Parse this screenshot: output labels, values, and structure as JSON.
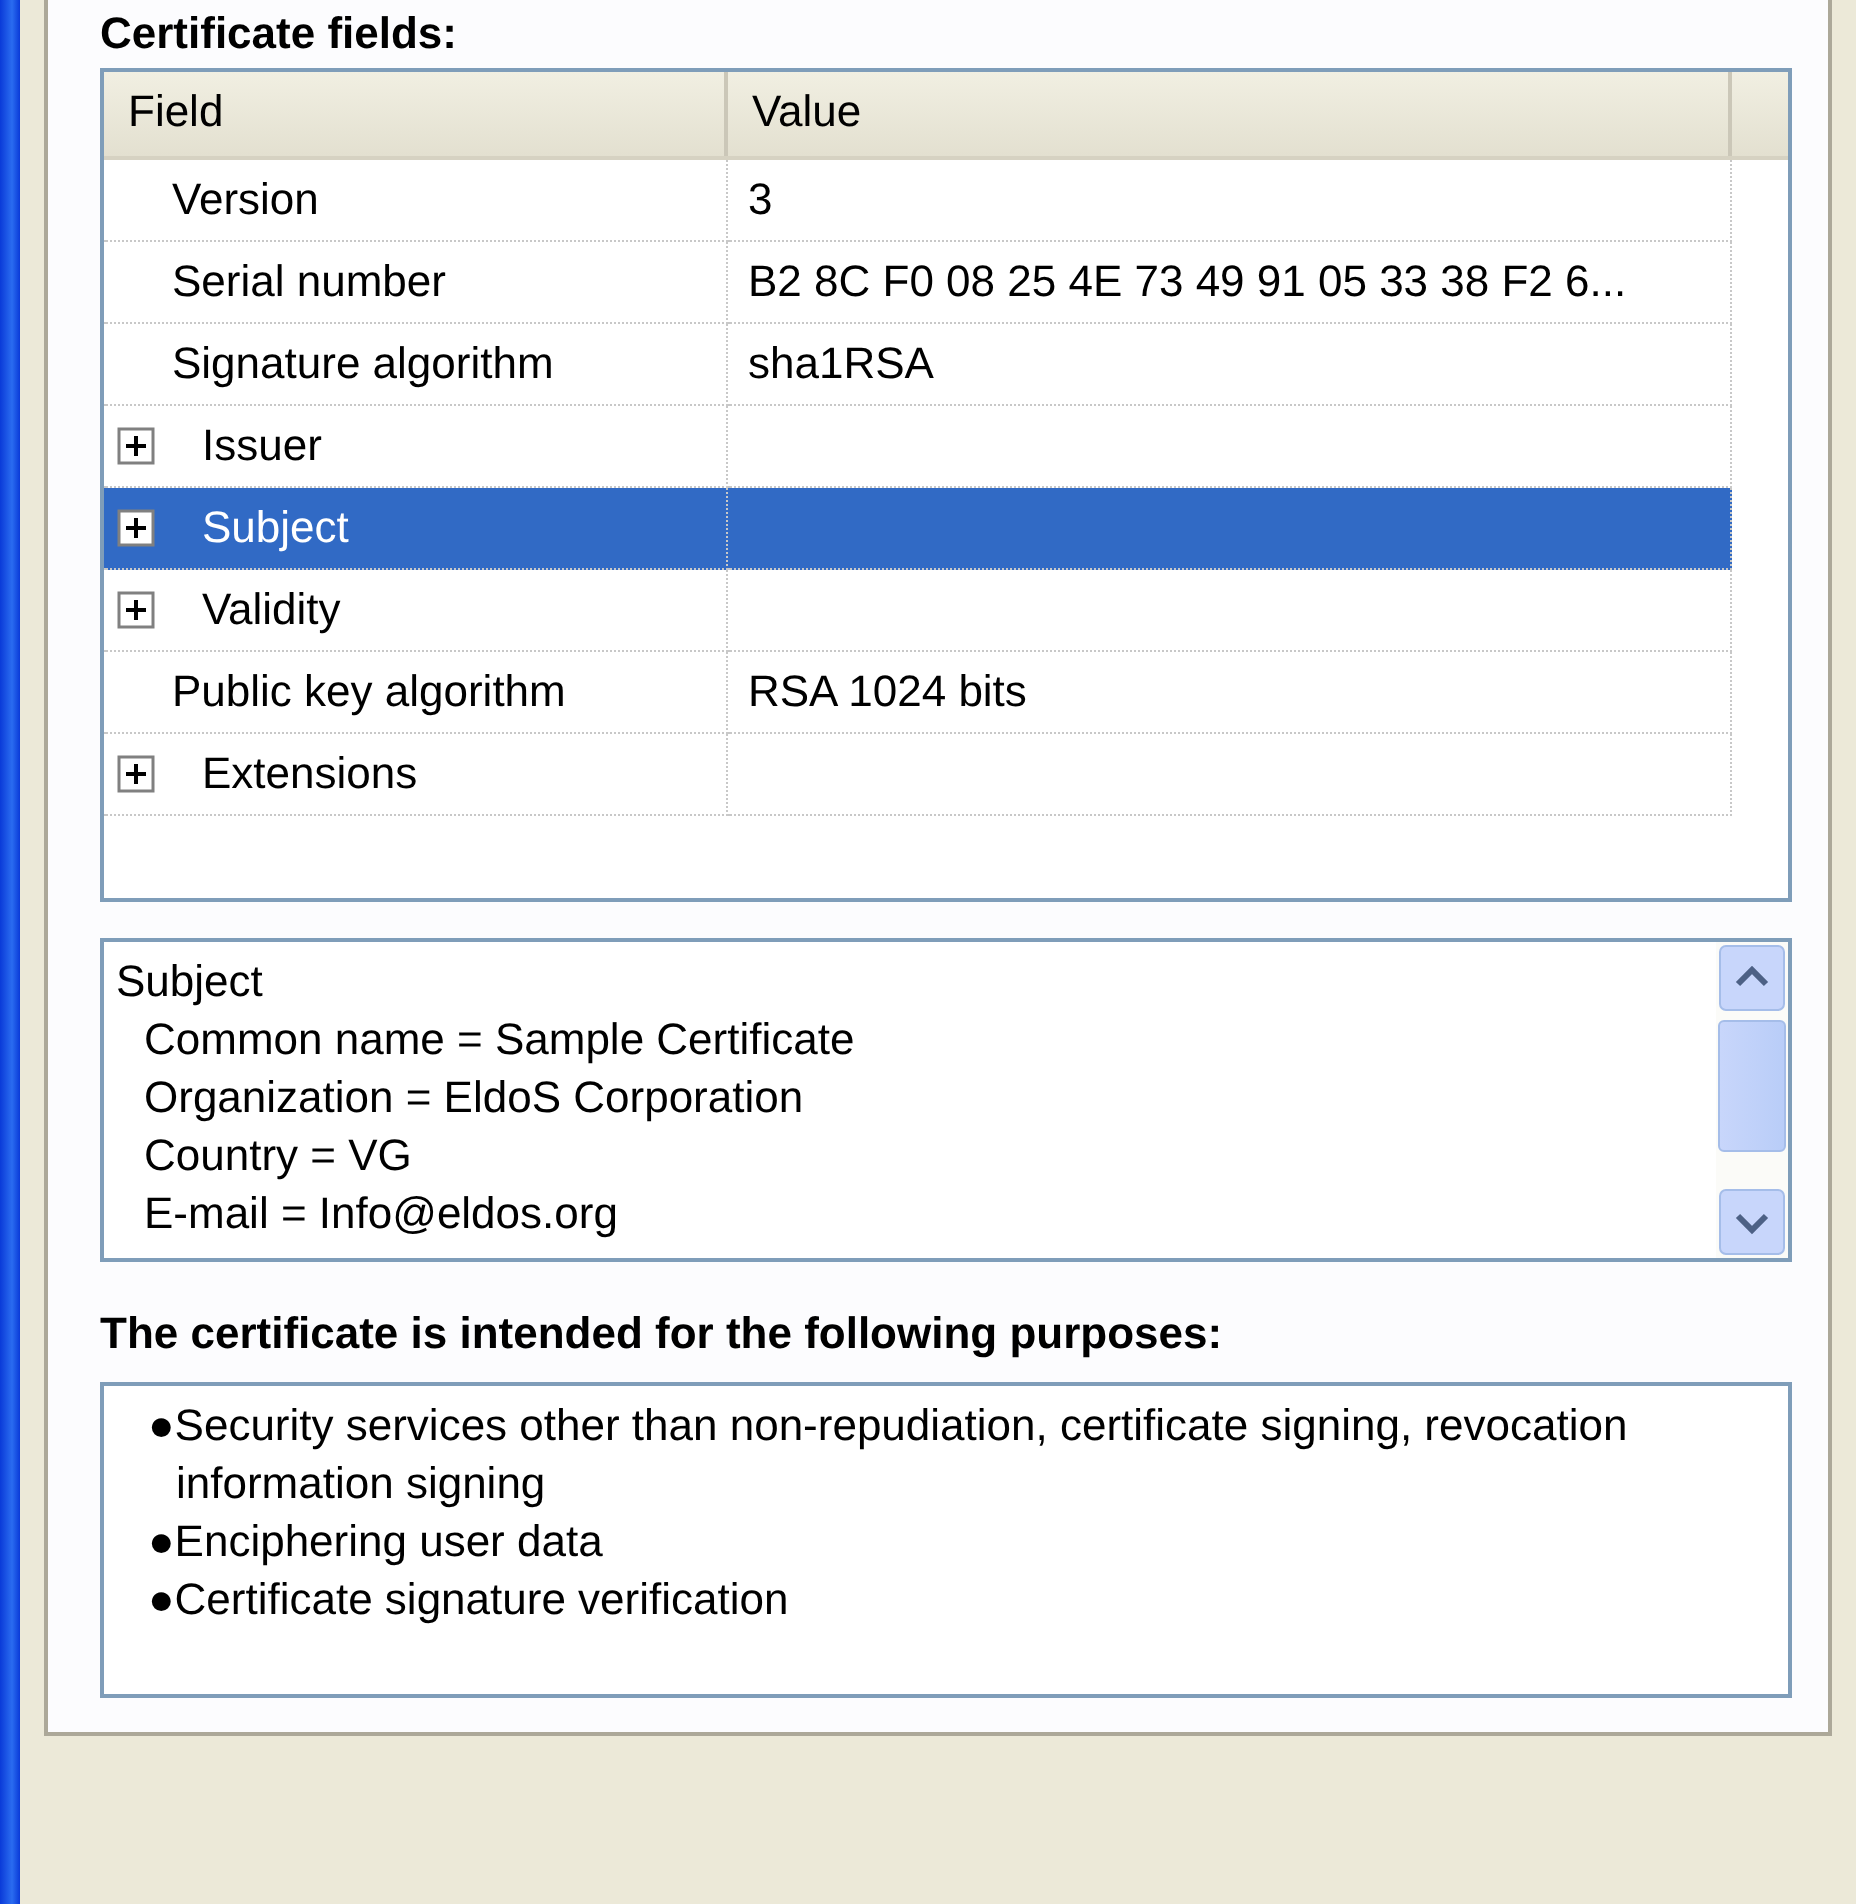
{
  "section_label": "Certificate fields:",
  "table": {
    "columns": [
      "Field",
      "Value"
    ],
    "rows": [
      {
        "field": "Version",
        "value": "3",
        "expandable": false,
        "selected": false
      },
      {
        "field": "Serial number",
        "value": "B2 8C F0 08 25 4E 73 49 91 05 33 38 F2 6...",
        "expandable": false,
        "selected": false
      },
      {
        "field": "Signature algorithm",
        "value": "sha1RSA",
        "expandable": false,
        "selected": false
      },
      {
        "field": "Issuer",
        "value": "",
        "expandable": true,
        "expanded": false,
        "selected": false
      },
      {
        "field": "Subject",
        "value": "",
        "expandable": true,
        "expanded": false,
        "selected": true
      },
      {
        "field": "Validity",
        "value": "",
        "expandable": true,
        "expanded": false,
        "selected": false
      },
      {
        "field": "Public key algorithm",
        "value": "RSA 1024 bits",
        "expandable": false,
        "selected": false
      },
      {
        "field": "Extensions",
        "value": "",
        "expandable": true,
        "expanded": false,
        "selected": false
      }
    ]
  },
  "details": {
    "heading": "Subject",
    "lines": [
      "Common name = Sample Certificate",
      "Organization = EldoS Corporation",
      "Country = VG",
      "E-mail = Info@eldos.org"
    ]
  },
  "purposes_heading": "The certificate is intended for the following purposes:",
  "purposes": [
    "●Security services other than non-repudiation, certificate signing, revocation information signing",
    "●Enciphering user data",
    "●Certificate signature verification"
  ]
}
